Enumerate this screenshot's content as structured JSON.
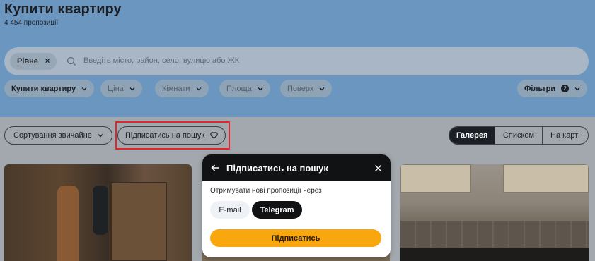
{
  "header": {
    "title": "Купити квартиру",
    "count": "4 454 пропозиції"
  },
  "search": {
    "city_chip": "Рівне",
    "city_chip_remove": "×",
    "placeholder": "Введіть місто, район, село, вулицю або ЖК"
  },
  "filters": {
    "deal": "Купити квартиру",
    "price": "Ціна",
    "rooms": "Кімнати",
    "area": "Площа",
    "floor": "Поверх",
    "more": "Фільтри",
    "more_count": "2"
  },
  "toolbar": {
    "sort": "Сортування звичайне",
    "subscribe": "Підписатись на пошук"
  },
  "view": {
    "gallery": "Галерея",
    "list": "Списком",
    "map": "На карті",
    "active": "gallery"
  },
  "modal": {
    "title": "Підписатись на пошук",
    "receive_label": "Отримувати нові пропозиції через",
    "email": "E-mail",
    "telegram": "Telegram",
    "selected": "telegram",
    "submit": "Підписатись"
  },
  "colors": {
    "accent": "#f9a70f",
    "highlight": "#e0262a",
    "dark": "#111214"
  }
}
